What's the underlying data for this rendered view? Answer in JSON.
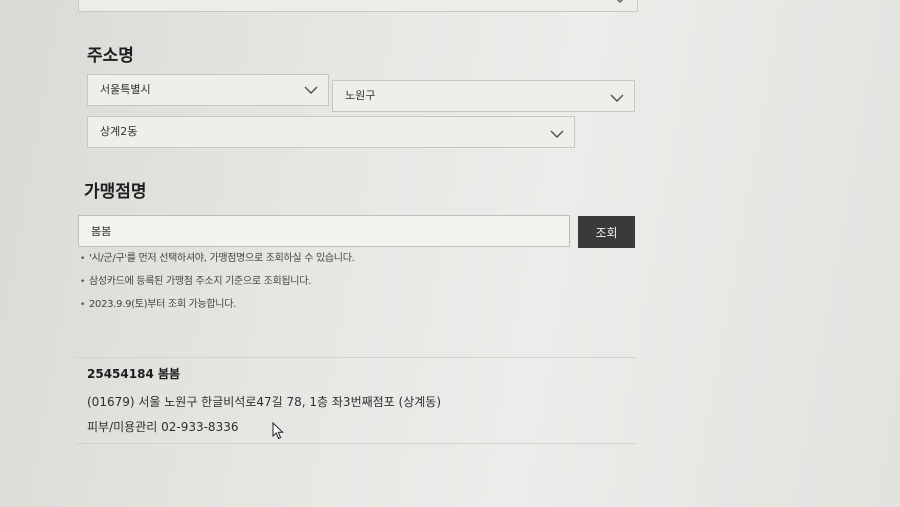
{
  "address": {
    "title": "주소명",
    "city": "서울특별시",
    "district": "노원구",
    "dong": "상계2동"
  },
  "store": {
    "title": "가맹점명",
    "input_value": "봄봄",
    "search_label": "조회"
  },
  "notes": [
    "'시/군/구'를 먼저 선택하셔야, 가맹점명으로 조회하실 수 있습니다.",
    "삼성카드에 등록된 가맹점 주소지 기준으로 조회됩니다.",
    "2023.9.9(토)부터 조회 가능합니다."
  ],
  "result": {
    "title": "25454184 봄봄",
    "address": "(01679) 서울 노원구 한글비석로47길 78, 1층 좌3번째점포 (상계동)",
    "category": "피부/미용관리 02-933-8336"
  },
  "icons": {
    "dropdown": "chevron-down-icon",
    "pointer": "mouse-cursor-icon"
  }
}
